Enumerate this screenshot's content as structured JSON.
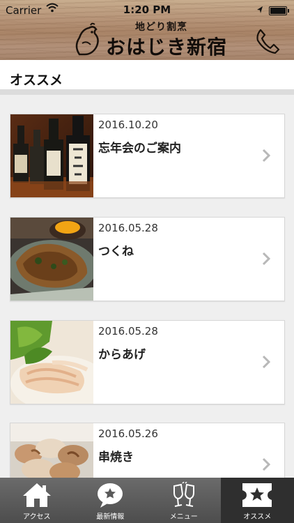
{
  "status_bar": {
    "carrier": "Carrier",
    "time": "1:20 PM"
  },
  "header": {
    "logo_sub": "地どり割烹",
    "logo_main": "おはじき新宿"
  },
  "section": {
    "title": "オススメ"
  },
  "items": [
    {
      "date": "2016.10.20",
      "title": "忘年会のご案内",
      "image": "sake-bottles"
    },
    {
      "date": "2016.05.28",
      "title": "つくね",
      "image": "tsukune-plate"
    },
    {
      "date": "2016.05.28",
      "title": "からあげ",
      "image": "chicken-salad"
    },
    {
      "date": "2016.05.26",
      "title": "串焼き",
      "image": "yakitori-skewers"
    }
  ],
  "tabs": [
    {
      "label": "アクセス",
      "icon": "home-icon",
      "active": false
    },
    {
      "label": "最新情報",
      "icon": "speech-bubble-icon",
      "active": false
    },
    {
      "label": "メニュー",
      "icon": "toast-glasses-icon",
      "active": false
    },
    {
      "label": "オススメ",
      "icon": "star-ticket-icon",
      "active": true
    }
  ],
  "colors": {
    "tab_active": "#2f2f2f",
    "tab_bg": "#5a5a5a",
    "divider": "#dcdcdc"
  }
}
